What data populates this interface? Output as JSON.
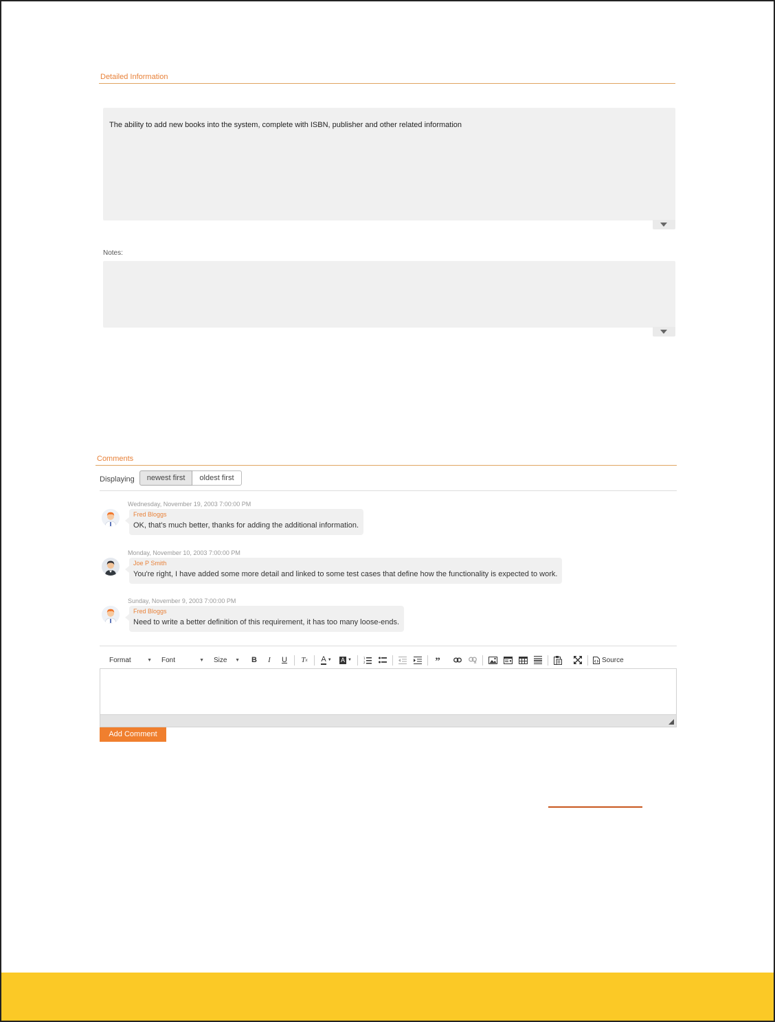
{
  "detailed_info": {
    "title": "Detailed Information",
    "description_text": "The ability to add new books into the system, complete with ISBN, publisher and other related information",
    "notes_label": "Notes:",
    "notes_text": ""
  },
  "comments": {
    "title": "Comments",
    "sort": {
      "label": "Displaying",
      "options": [
        "newest first",
        "oldest first"
      ],
      "selected": "newest first"
    },
    "items": [
      {
        "date": "Wednesday, November 19, 2003 7:00:00 PM",
        "author": "Fred Bloggs",
        "text": "OK, that's much better, thanks for adding the additional information.",
        "avatar": "avatar-orange-hair"
      },
      {
        "date": "Monday, November 10, 2003 7:00:00 PM",
        "author": "Joe P Smith",
        "text": "You're right, I have added some more detail and linked to some test cases that define how the functionality is expected to work.",
        "avatar": "avatar-dark-hair"
      },
      {
        "date": "Sunday, November 9, 2003 7:00:00 PM",
        "author": "Fred Bloggs",
        "text": "Need to write a better definition of this requirement, it has too many loose-ends.",
        "avatar": "avatar-orange-hair"
      }
    ]
  },
  "editor": {
    "format_label": "Format",
    "font_label": "Font",
    "size_label": "Size",
    "source_label": "Source",
    "value": ""
  },
  "add_comment_label": "Add Comment",
  "colors": {
    "accent": "#e8823a",
    "button": "#f07f2e",
    "footer": "#fbc926"
  }
}
